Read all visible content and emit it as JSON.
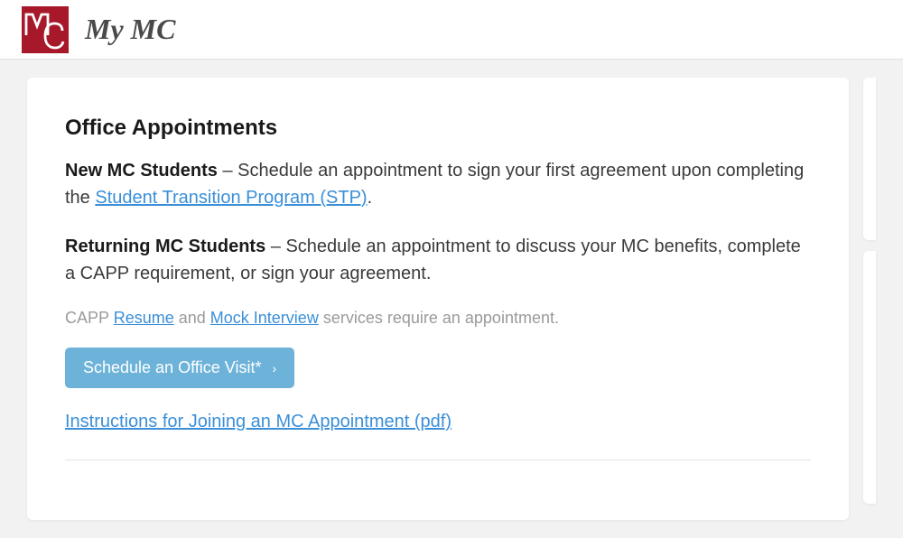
{
  "header": {
    "site_title": "My MC"
  },
  "main": {
    "section_title": "Office Appointments",
    "para1": {
      "bold": "New MC Students",
      "text_before_link": " – Schedule an appointment to sign your first agreement upon completing the ",
      "link_text": "Student Transition Program (STP)",
      "text_after_link": "."
    },
    "para2": {
      "bold": "Returning MC Students",
      "text": " – Schedule an appointment to discuss your MC benefits, complete a CAPP requirement, or sign your agreement."
    },
    "capp_line": {
      "prefix": "CAPP ",
      "link1": "Resume",
      "mid": " and ",
      "link2": "Mock Interview",
      "suffix": " services require an appointment."
    },
    "button_label": "Schedule an Office Visit*",
    "instructions_link": "Instructions for Joining an MC Appointment (pdf)"
  }
}
